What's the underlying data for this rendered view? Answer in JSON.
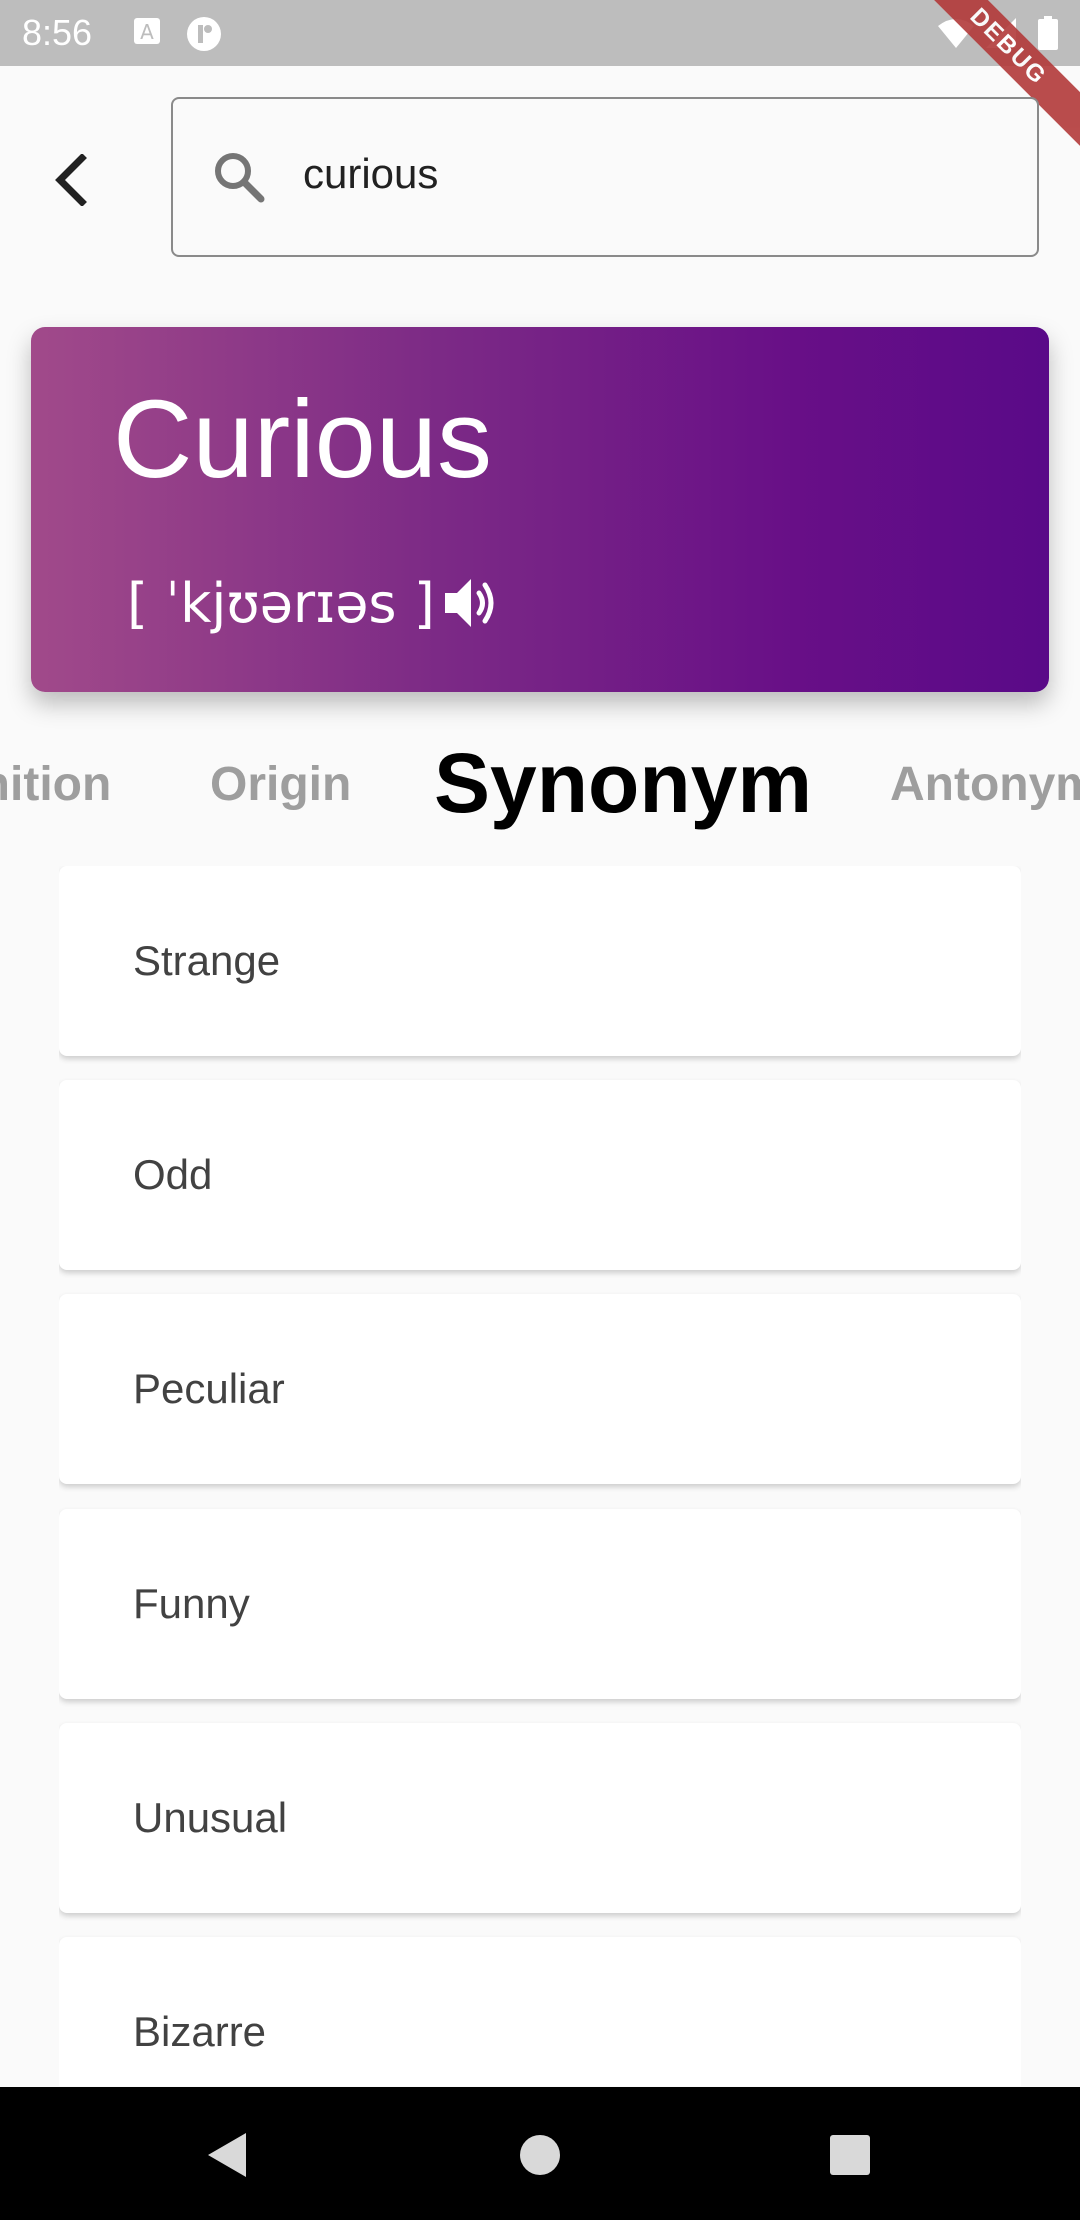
{
  "status_bar": {
    "time": "8:56",
    "icons": [
      "text-a-icon",
      "notification-circle-icon",
      "wifi-icon",
      "signal-icon",
      "battery-icon"
    ],
    "debug_label": "DEBUG"
  },
  "search": {
    "value": "curious",
    "icon": "search-icon"
  },
  "word": {
    "title": "Curious",
    "phonetic": "[ ˈkjʊərɪəs ]",
    "speaker_icon": "volume-icon"
  },
  "tabs": [
    {
      "label": "Definition",
      "active": false
    },
    {
      "label": "Origin",
      "active": false
    },
    {
      "label": "Synonym",
      "active": true
    },
    {
      "label": "Antonym",
      "active": false
    }
  ],
  "synonyms": [
    "Strange",
    "Odd",
    "Peculiar",
    "Funny",
    "Unusual",
    "Bizarre"
  ],
  "colors": {
    "gradient_start": "#a14a8a",
    "gradient_end": "#5a0a88",
    "background": "#fafafa",
    "status_bar": "#bdbdbd",
    "tab_inactive": "#9e9e9e"
  }
}
